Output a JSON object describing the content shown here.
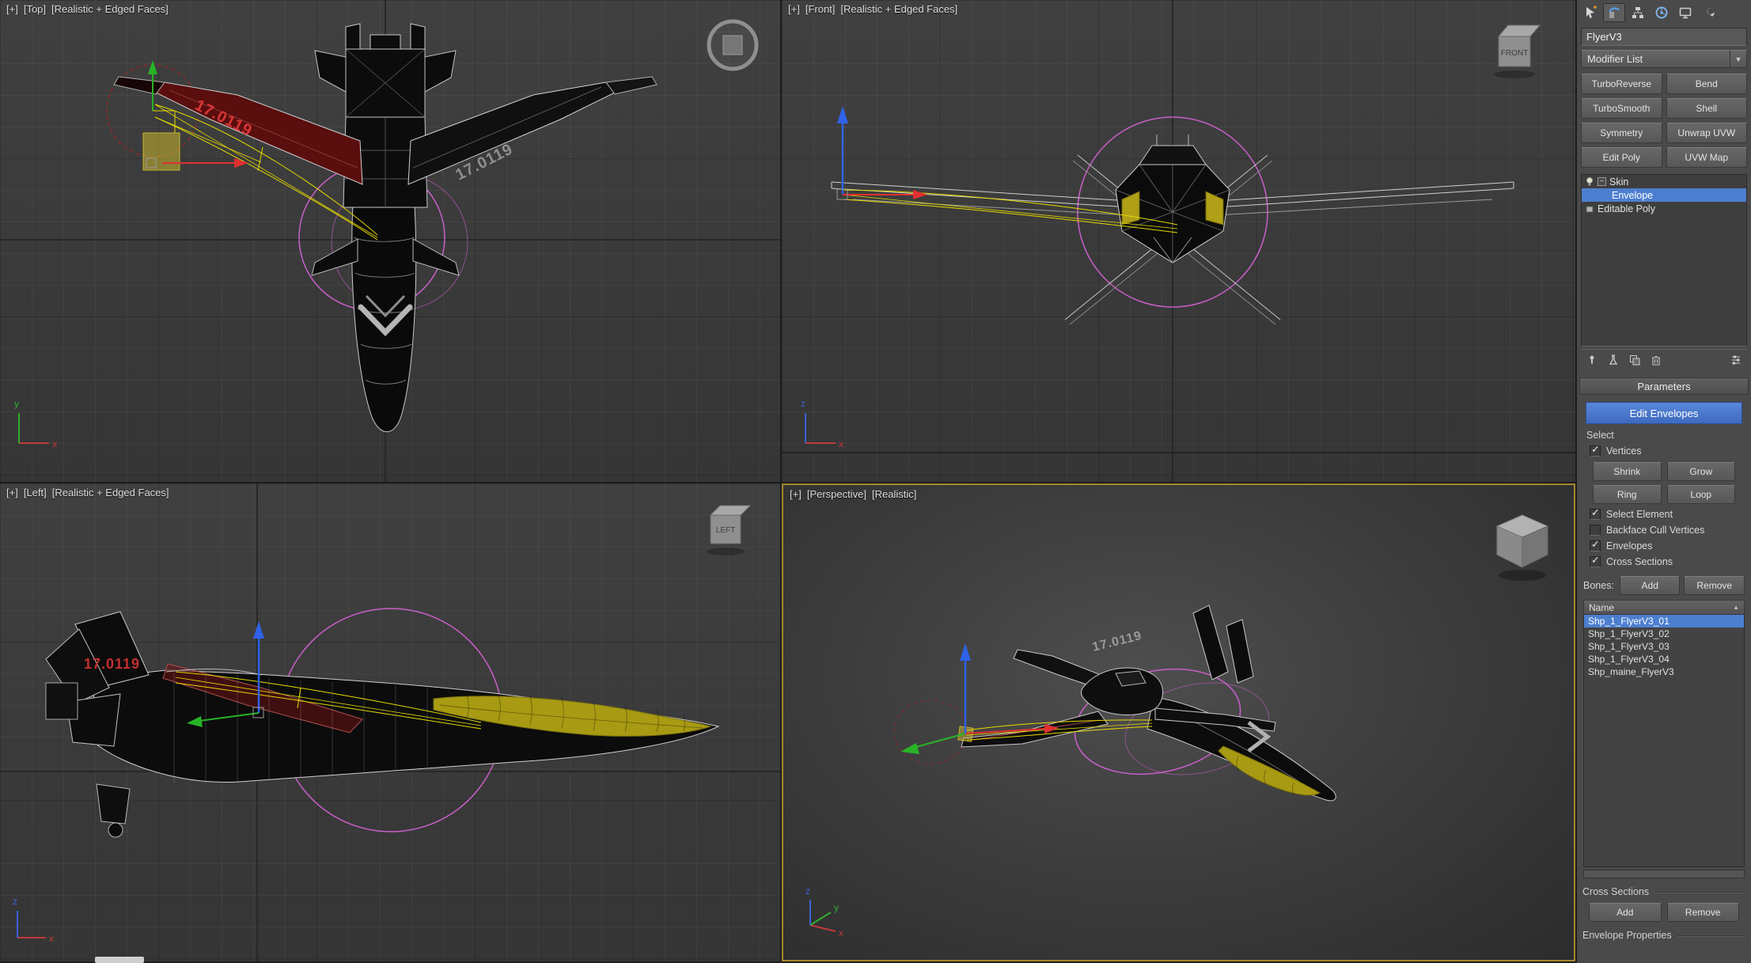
{
  "viewports": {
    "top": {
      "menu": "[+]",
      "name": "[Top]",
      "shading": "[Realistic + Edged Faces]"
    },
    "front": {
      "menu": "[+]",
      "name": "[Front]",
      "shading": "[Realistic + Edged Faces]"
    },
    "left": {
      "menu": "[+]",
      "name": "[Left]",
      "shading": "[Realistic + Edged Faces]"
    },
    "perspective": {
      "menu": "[+]",
      "name": "[Perspective]",
      "shading": "[Realistic]"
    },
    "decal": "17.0119",
    "viewcube": {
      "front": "FRONT",
      "left": "LEFT"
    },
    "axis_labels": {
      "x": "x",
      "y": "y",
      "z": "z"
    }
  },
  "command_panel": {
    "object_name": "FlyerV3",
    "modifier_list_label": "Modifier List",
    "modifier_buttons": [
      "TurboReverse",
      "Bend",
      "TurboSmooth",
      "Shell",
      "Symmetry",
      "Unwrap UVW",
      "Edit Poly",
      "UVW Map"
    ],
    "stack": {
      "skin": "Skin",
      "envelope": "Envelope",
      "editable_poly": "Editable Poly"
    },
    "rollout_parameters": "Parameters",
    "edit_envelopes": "Edit Envelopes",
    "select_label": "Select",
    "checkboxes": {
      "vertices": "Vertices",
      "select_element": "Select Element",
      "backface": "Backface Cull Vertices",
      "envelopes": "Envelopes",
      "cross_sections": "Cross Sections"
    },
    "sel_buttons": {
      "shrink": "Shrink",
      "grow": "Grow",
      "ring": "Ring",
      "loop": "Loop"
    },
    "bones_label": "Bones:",
    "add_label": "Add",
    "remove_label": "Remove",
    "name_header": "Name",
    "bones": [
      "Shp_1_FlyerV3_01",
      "Shp_1_FlyerV3_02",
      "Shp_1_FlyerV3_03",
      "Shp_1_FlyerV3_04",
      "Shp_maine_FlyerV3"
    ],
    "cross_sections_label": "Cross Sections",
    "cs_add_label": "Add",
    "cs_remove_label": "Remove",
    "envelope_properties_label": "Envelope Properties"
  },
  "icons": {
    "dropdown_arrow": "▼",
    "sort_ascending": "▲",
    "checkmark": "✓",
    "collapse": "−"
  },
  "colors": {
    "selection_blue": "#4d7fd0",
    "active_viewport_border": "#a5882e",
    "envelope_magenta": "#c95fc9",
    "envelope_yellow": "#e6da00"
  }
}
